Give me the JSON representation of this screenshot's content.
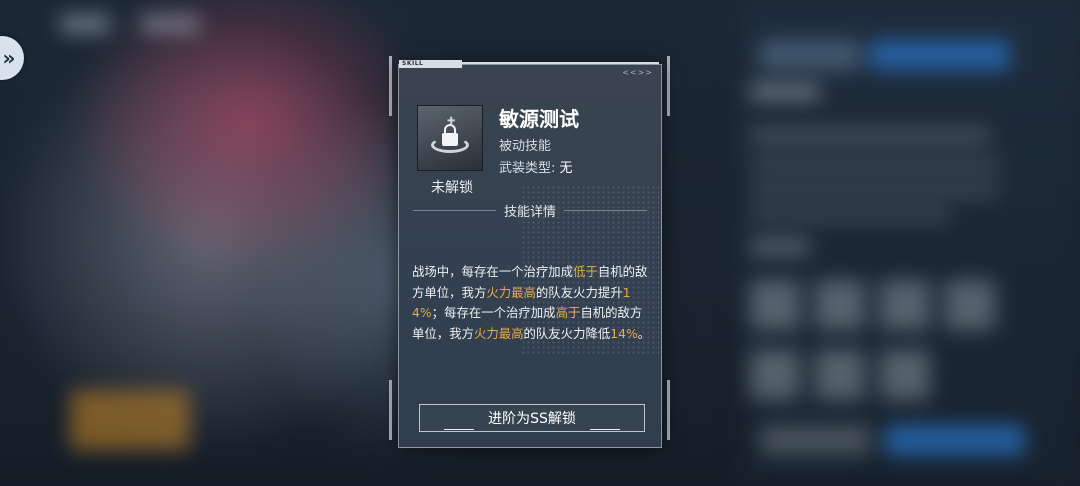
{
  "dialog": {
    "tag": "SKILL",
    "corner_mark": "<<>>",
    "skill_name": "敏源测试",
    "skill_type": "被动技能",
    "armor_type_label": "武装类型:",
    "armor_type_value": "无",
    "lock_status": "未解锁",
    "icon": "lock-icon",
    "detail_header": "技能详情",
    "description": [
      {
        "t": "战场中，每存在一个治疗加成",
        "hl": false
      },
      {
        "t": "低于",
        "hl": true
      },
      {
        "t": "自机的敌方单位，我方",
        "hl": false
      },
      {
        "t": "火力最高",
        "hl": true
      },
      {
        "t": "的队友火力提升",
        "hl": false
      },
      {
        "t": "14%",
        "hl": true
      },
      {
        "t": "；每存在一个治疗加成",
        "hl": false
      },
      {
        "t": "高于",
        "hl": true
      },
      {
        "t": "自机的敌方单位，我方",
        "hl": false
      },
      {
        "t": "火力最高",
        "hl": true
      },
      {
        "t": "的队友火力降低",
        "hl": false
      },
      {
        "t": "14%",
        "hl": true
      },
      {
        "t": "。",
        "hl": false
      }
    ],
    "unlock_button": "进阶为SS解锁"
  },
  "sidebar": {
    "toggle_icon": "double-chevron-right-icon"
  },
  "colors": {
    "highlight": "#e6a94b",
    "panel": "#334050"
  }
}
